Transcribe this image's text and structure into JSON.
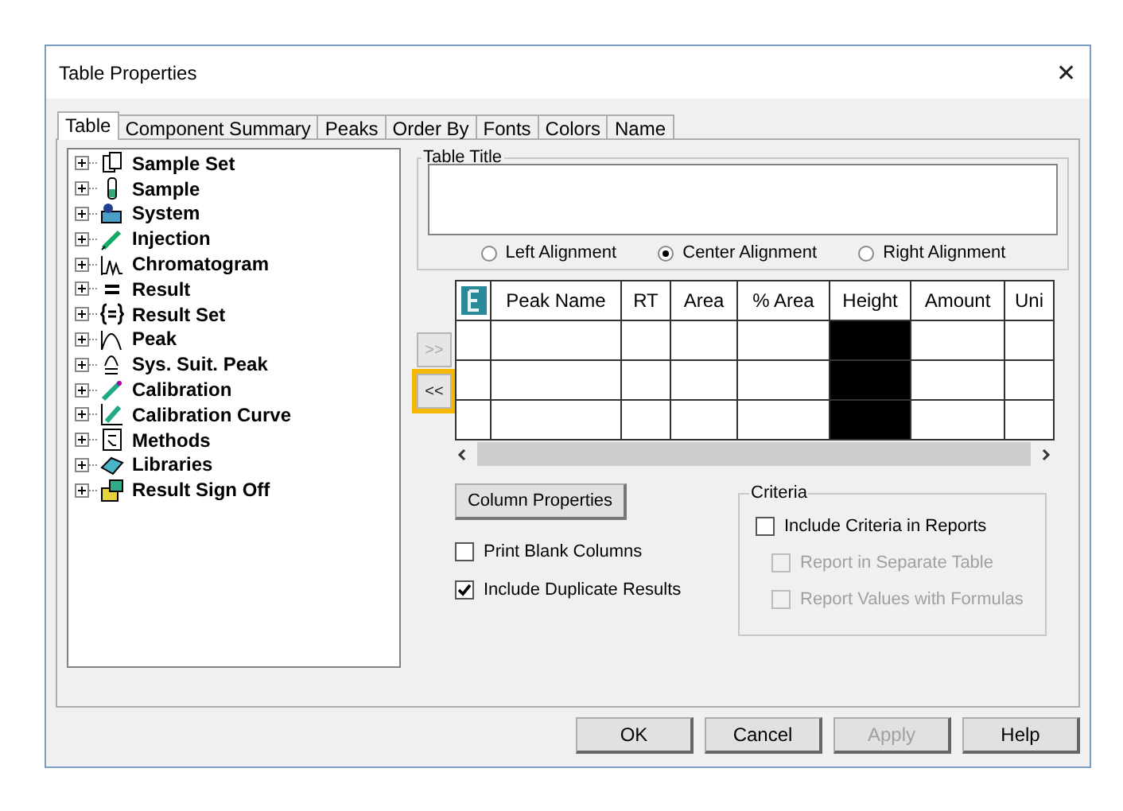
{
  "window": {
    "title": "Table Properties",
    "close": "✕"
  },
  "tabs": [
    {
      "label": "Table",
      "selected": true
    },
    {
      "label": "Component Summary",
      "selected": false
    },
    {
      "label": "Peaks",
      "selected": false
    },
    {
      "label": "Order By",
      "selected": false
    },
    {
      "label": "Fonts",
      "selected": false
    },
    {
      "label": "Colors",
      "selected": false
    },
    {
      "label": "Name",
      "selected": false
    }
  ],
  "tree": {
    "items": [
      {
        "label": "Sample Set"
      },
      {
        "label": "Sample"
      },
      {
        "label": "System"
      },
      {
        "label": "Injection"
      },
      {
        "label": "Chromatogram"
      },
      {
        "label": "Result"
      },
      {
        "label": "Result Set"
      },
      {
        "label": "Peak"
      },
      {
        "label": "Sys. Suit. Peak"
      },
      {
        "label": "Calibration"
      },
      {
        "label": "Calibration Curve"
      },
      {
        "label": "Methods"
      },
      {
        "label": "Libraries"
      },
      {
        "label": "Result Sign Off"
      }
    ]
  },
  "table_title": {
    "label": "Table Title",
    "alignments": [
      {
        "label": "Left Alignment",
        "selected": false
      },
      {
        "label": "Center Alignment",
        "selected": true
      },
      {
        "label": "Right Alignment",
        "selected": false
      }
    ]
  },
  "move_buttons": [
    {
      "label": ">>",
      "disabled": true,
      "highlighted": false
    },
    {
      "label": "<<",
      "disabled": false,
      "highlighted": true
    }
  ],
  "grid": {
    "columns": [
      {
        "label": "Peak Name",
        "selected": false
      },
      {
        "label": "RT",
        "selected": false
      },
      {
        "label": "Area",
        "selected": false
      },
      {
        "label": "% Area",
        "selected": false
      },
      {
        "label": "Height",
        "selected": true
      },
      {
        "label": "Amount",
        "selected": false
      },
      {
        "label": "Uni",
        "selected": false
      }
    ]
  },
  "column_properties_button": "Column Properties",
  "options": [
    {
      "label": "Print Blank Columns",
      "checked": false
    },
    {
      "label": "Include Duplicate Results",
      "checked": true
    }
  ],
  "criteria": {
    "label": "Criteria",
    "items": [
      {
        "label": "Include Criteria in Reports",
        "checked": false,
        "disabled": false
      },
      {
        "label": "Report in Separate Table",
        "checked": false,
        "disabled": true
      },
      {
        "label": "Report Values with Formulas",
        "checked": false,
        "disabled": true
      }
    ]
  },
  "buttons": [
    {
      "label": "OK",
      "disabled": false
    },
    {
      "label": "Cancel",
      "disabled": false
    },
    {
      "label": "Apply",
      "disabled": true
    },
    {
      "label": "Help",
      "disabled": false
    }
  ]
}
